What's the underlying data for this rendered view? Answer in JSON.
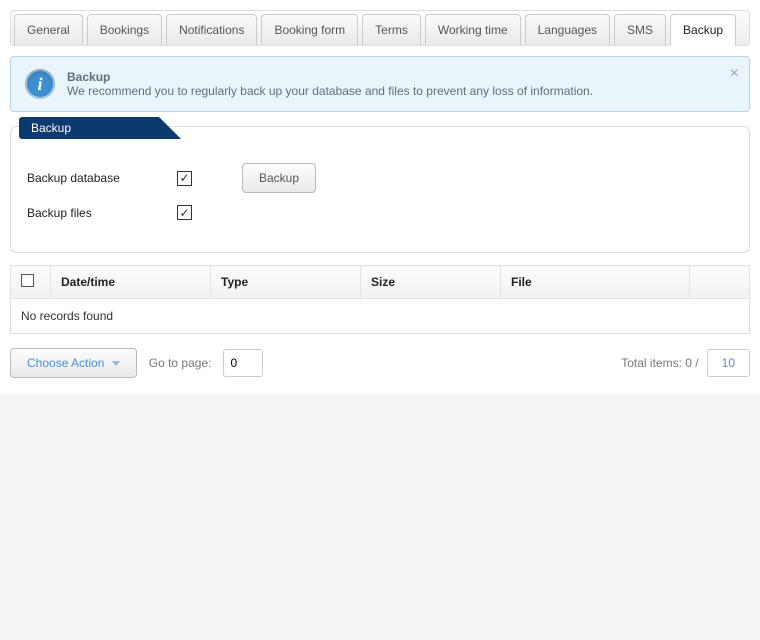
{
  "tabs": {
    "items": [
      {
        "label": "General"
      },
      {
        "label": "Bookings"
      },
      {
        "label": "Notifications"
      },
      {
        "label": "Booking form"
      },
      {
        "label": "Terms"
      },
      {
        "label": "Working time"
      },
      {
        "label": "Languages"
      },
      {
        "label": "SMS"
      },
      {
        "label": "Backup"
      }
    ],
    "activeIndex": 8
  },
  "alert": {
    "title": "Backup",
    "message": "We recommend you to regularly back up your database and files to prevent any loss of information.",
    "icon_glyph": "i"
  },
  "panel": {
    "title": "Backup",
    "rows": {
      "database_label": "Backup database",
      "files_label": "Backup files",
      "backup_button": "Backup"
    }
  },
  "table": {
    "columns": {
      "datetime": "Date/time",
      "type": "Type",
      "size": "Size",
      "file": "File"
    },
    "empty_text": "No records found"
  },
  "footer": {
    "choose_action": "Choose Action",
    "goto_label": "Go to page:",
    "goto_value": "0",
    "total_prefix": "Total items: ",
    "total_count": "0",
    "total_sep": " / ",
    "per_page": "10"
  }
}
